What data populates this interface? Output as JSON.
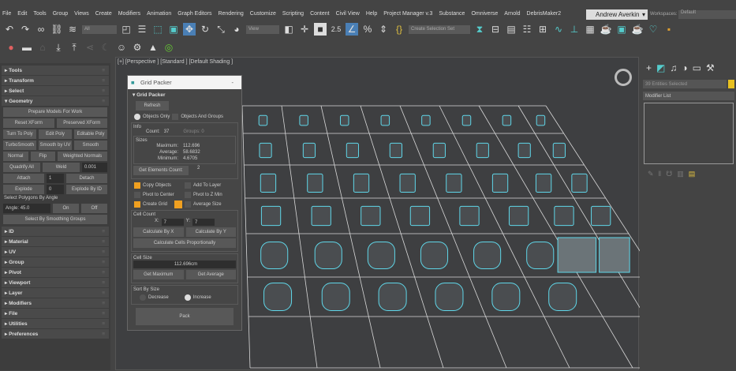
{
  "menu": [
    "File",
    "Edit",
    "Tools",
    "Group",
    "Views",
    "Create",
    "Modifiers",
    "Animation",
    "Graph Editors",
    "Rendering",
    "Customize",
    "Scripting",
    "Content",
    "Civil View",
    "Help",
    "Project Manager v.3",
    "Substance",
    "Omniverse",
    "Arnold",
    "DebrisMaker2"
  ],
  "user": "Andrew Averkin",
  "workspaces_label": "Workspaces:",
  "workspace": "Default",
  "toolbar": {
    "filter": "All",
    "refcoord": "View",
    "selection_set": "Create Selection Set",
    "snap_label": "2.5"
  },
  "viewport_label": "[+] [Perspective ] [Standard ] [Default Shading ]",
  "left_panel": {
    "rollouts_top": [
      "Tools",
      "Transform",
      "Select"
    ],
    "geometry": "Geometry",
    "prepare": "Prepare Models For Work",
    "reset_xform": "Reset XForm",
    "preserved_xform": "Preserved XForm",
    "turn_to_poly": "Turn To Poly",
    "edit_poly": "Edit Poly",
    "editable_poly": "Editable Poly",
    "turbosmooth": "TurboSmooth",
    "smooth_by_uv": "Smooth by UV",
    "smooth": "Smooth",
    "normal": "Normal",
    "flip": "Flip",
    "weighted_normals": "Weighted Normals",
    "quadrify": "Quadrify All",
    "weld": "Weld",
    "weld_value": "0.001",
    "attach": "Attach",
    "attach_value": "1",
    "detach": "Detach",
    "explode": "Explode",
    "explode_value": "0",
    "explode_by_id": "Explode By ID",
    "select_by_angle": "Select Polygons By Angle",
    "angle_label": "Angle:",
    "angle_value": "45.0",
    "on": "On",
    "off": "Off",
    "select_smoothing": "Select By Smoothing Groups",
    "rollouts_bottom": [
      "ID",
      "Material",
      "UV",
      "Group",
      "Pivot",
      "Viewport",
      "Layer",
      "Modifiers",
      "File",
      "Utilities",
      "Preferences"
    ]
  },
  "grid_packer": {
    "window_title": "Grid Packer",
    "rollout": "Grid Packer",
    "refresh": "Refresh",
    "objects_only": "Objects Only",
    "objects_and_groups": "Objects And Groups",
    "info": "Info",
    "count_label": "Count:",
    "count": "37",
    "groups": "Groups:",
    "groups_value": "0",
    "sizes": "Sizes",
    "max_label": "Maximum:",
    "max": "112.696",
    "avg_label": "Average:",
    "avg": "58.6832",
    "min_label": "Minimum:",
    "min": "4.6705",
    "get_elements": "Get Elements Count:",
    "elements": "2",
    "copy_objects": "Copy Objects",
    "add_to_layer": "Add To Layer",
    "pivot_center": "Pivot to Center",
    "pivot_zmin": "Pivot to Z Min",
    "create_grid": "Create Grid",
    "average_size": "Average Size",
    "cell_count": "Cell Count",
    "x_label": "X:",
    "x": "7",
    "y_label": "Y:",
    "y": "7",
    "calc_x": "Calculate By X",
    "calc_y": "Calculate By Y",
    "calc_prop": "Calculate Cells Proportionally",
    "cell_size": "Cell Size",
    "cell_size_value": "112.696cm",
    "get_max": "Get Maximum",
    "get_avg": "Get Average",
    "sort_by_size": "Sort By Size",
    "decrease": "Decrease",
    "increase": "Increase",
    "pack": "Pack"
  },
  "right_panel": {
    "selected": "39 Entities Selected",
    "modifier_list": "Modifier List"
  },
  "colors": {
    "accent": "#f0a020",
    "object_outline": "#5fd6e8",
    "grid": "#d8d8d8"
  }
}
